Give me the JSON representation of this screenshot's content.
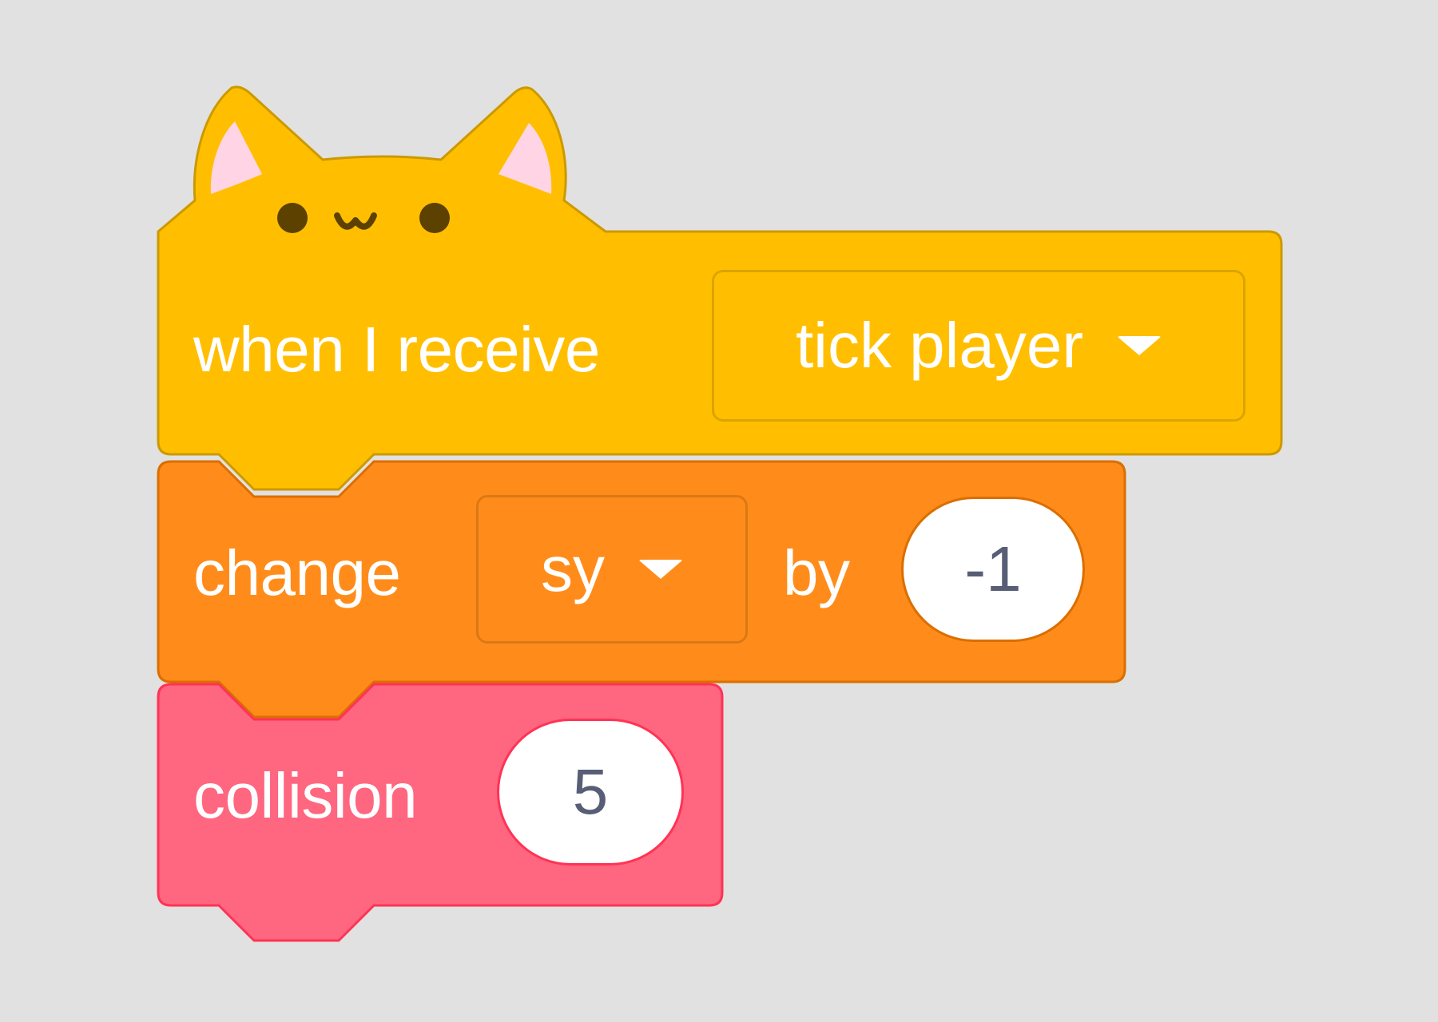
{
  "colors": {
    "background": "#e1e1e1",
    "events_block": "#ffbf00",
    "events_border": "#cc9900",
    "variables_block": "#ff8c1a",
    "variables_border": "#db6e00",
    "custom_block": "#ff6680",
    "custom_border": "#ff3355",
    "input_text": "#575e75",
    "ear_inner": "#ffd5e6",
    "face": "#5c4100"
  },
  "icons": {
    "cat_face": "cat-face-icon",
    "dropdown_arrow": "triangle-down-icon"
  },
  "blocks": {
    "hat": {
      "label": "when I receive",
      "message": "tick player"
    },
    "change": {
      "label": "change",
      "variable": "sy",
      "by_label": "by",
      "value": "-1"
    },
    "custom": {
      "label": "collision",
      "value": "5"
    }
  }
}
